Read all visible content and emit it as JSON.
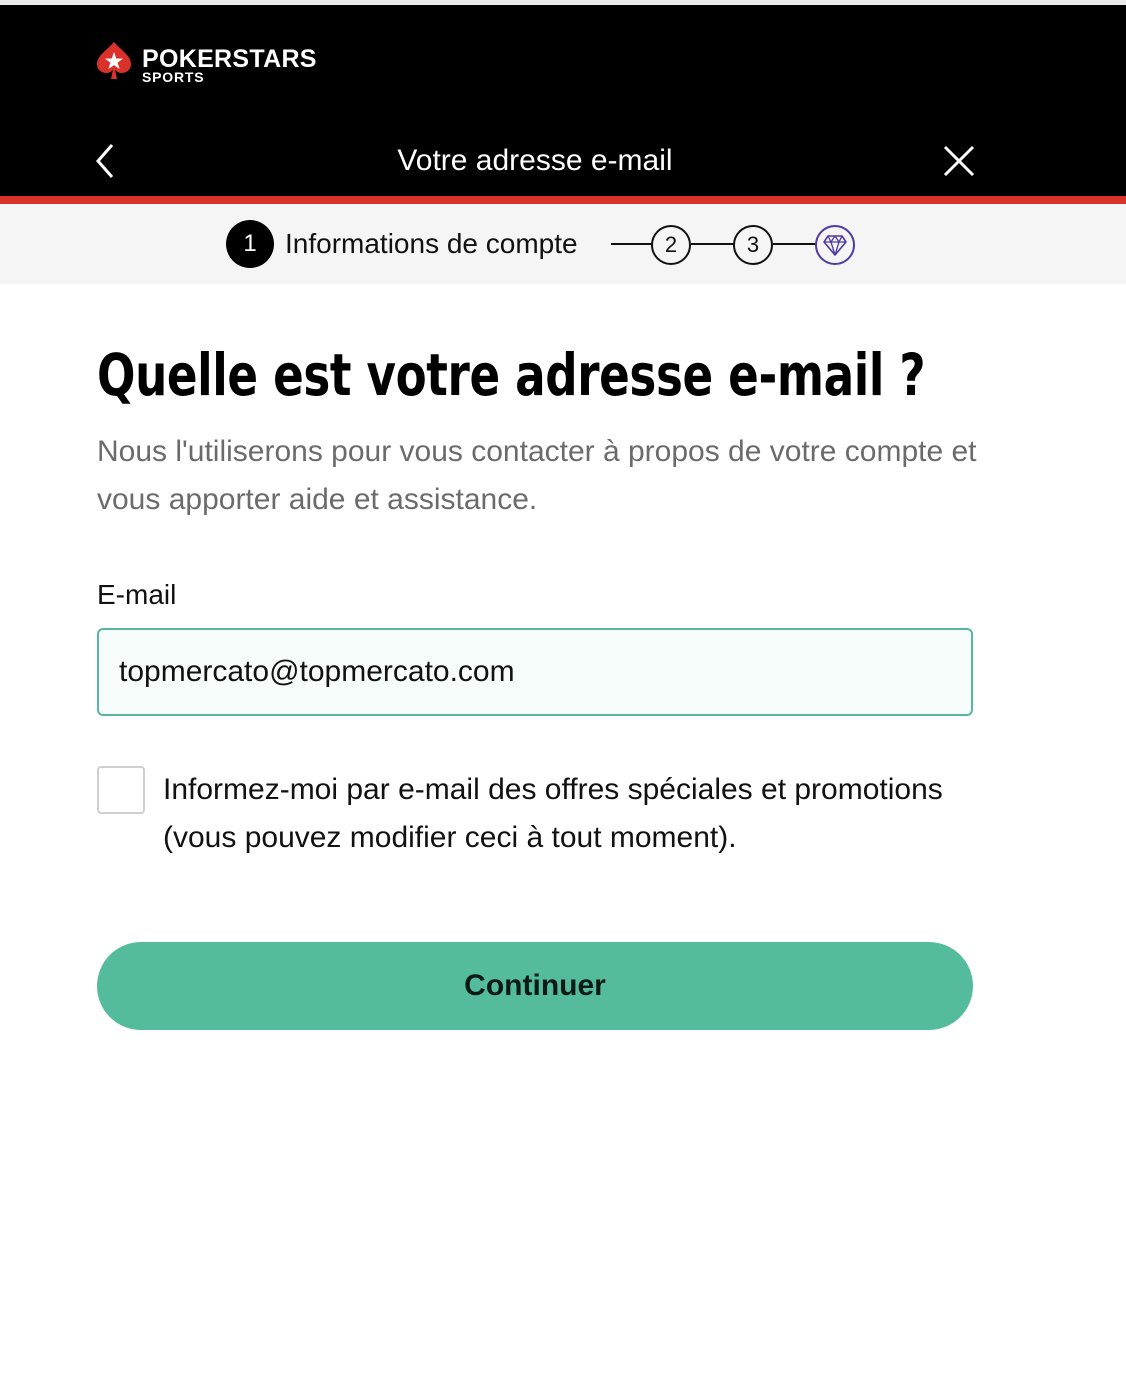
{
  "brand": {
    "name": "POKERSTARS",
    "sub": "SPORTS",
    "logo_icon": "spade-star-icon",
    "accent": "#d8322b"
  },
  "header": {
    "title": "Votre adresse e-mail",
    "back_icon": "chevron-left-icon",
    "close_icon": "close-icon"
  },
  "stepper": {
    "current_number": "1",
    "current_label": "Informations de compte",
    "steps": [
      "2",
      "3"
    ],
    "final_icon": "diamond-icon"
  },
  "content": {
    "heading": "Quelle est votre adresse e-mail ?",
    "subtitle": "Nous l'utiliserons pour vous contacter à propos de votre compte et vous apporter aide et assistance."
  },
  "form": {
    "email_label": "E-mail",
    "email_value": "topmercato@topmercato.com",
    "newsletter_label": "Informez-moi par e-mail des offres spéciales et promotions (vous pouvez modifier ceci à tout moment).",
    "newsletter_checked": false,
    "continue_label": "Continuer",
    "button_color": "#55bb9d"
  }
}
